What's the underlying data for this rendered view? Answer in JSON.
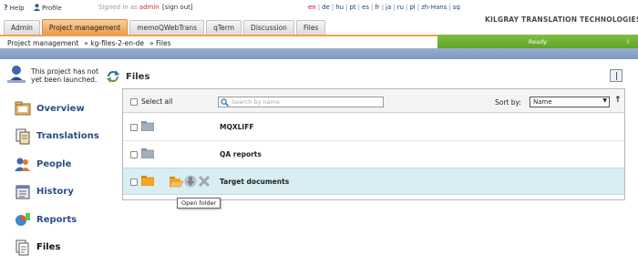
{
  "top": {
    "help": "Help",
    "profile": "Profile",
    "signed_in_prefix": "Signed in as",
    "user": "admin",
    "signout": "[sign out]"
  },
  "languages": [
    "en",
    "de",
    "hu",
    "pt",
    "es",
    "fr",
    "ja",
    "ru",
    "pl",
    "zh-Hans",
    "sq"
  ],
  "brand": {
    "name": "KILGRAY TRANSLATION TECHNOLOGIES"
  },
  "tabs": [
    "Admin",
    "Project management",
    "memoQWebTrans",
    "qTerm",
    "Discussion",
    "Files"
  ],
  "breadcrumb": [
    "Project management",
    "» kg-files-2-en-de",
    "» Files"
  ],
  "status": {
    "text": "Ready",
    "info": "i"
  },
  "project": {
    "note": "This project has not yet been launched."
  },
  "section_title": "Files",
  "nav": [
    {
      "label": "Overview",
      "icon": "overview-icon"
    },
    {
      "label": "Translations",
      "icon": "translations-icon"
    },
    {
      "label": "People",
      "icon": "people-icon"
    },
    {
      "label": "History",
      "icon": "history-icon"
    },
    {
      "label": "Reports",
      "icon": "reports-icon"
    },
    {
      "label": "Files",
      "icon": "files-icon"
    }
  ],
  "toolbar": {
    "select_all": "Select all",
    "search_placeholder": "Search by name",
    "sort_by": "Sort by:",
    "sort_value": "Name",
    "sort_dir": "↑"
  },
  "rows": [
    {
      "name": "MQXLIFF",
      "selected": false
    },
    {
      "name": "QA reports",
      "selected": false
    },
    {
      "name": "Target documents",
      "selected": true
    }
  ],
  "tooltip": "Open folder",
  "colors": {
    "accent_orange": "#ef9a4c",
    "status_green": "#5ea52a",
    "nav_blue": "#2b4e86",
    "selected_row": "#d8eef3"
  }
}
